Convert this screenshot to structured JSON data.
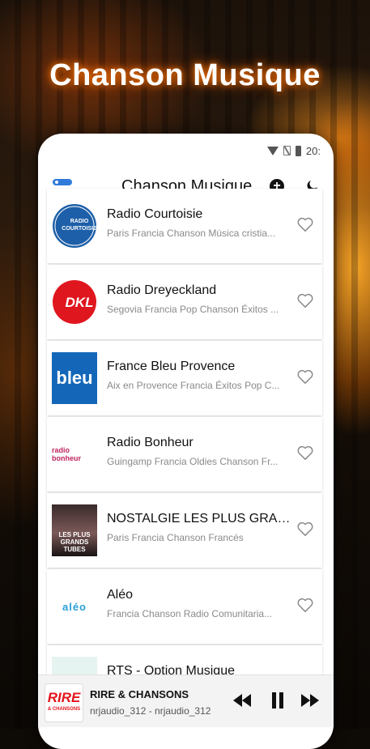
{
  "promo": {
    "title": "Chanson Musique"
  },
  "status_bar": {
    "time": "20:"
  },
  "app_bar": {
    "title": "Chanson Musique"
  },
  "stations": [
    {
      "name": "Radio Courtoisie",
      "description": "Paris Francia Chanson Música cristia...",
      "logo_text": "RADIO COURTOISIE"
    },
    {
      "name": "Radio Dreyeckland",
      "description": "Segovia Francia Pop Chanson Éxitos ...",
      "logo_text": "DKL"
    },
    {
      "name": "France Bleu Provence",
      "description": "Aix en Provence Francia Éxitos Pop C...",
      "logo_text": "bleu"
    },
    {
      "name": "Radio Bonheur",
      "description": "Guingamp Francia Oldies Chanson Fr...",
      "logo_text": "radio bonheur"
    },
    {
      "name": "NOSTALGIE LES PLUS GRAN...",
      "description": "Paris Francia Chanson Francés",
      "logo_text": "LES PLUS GRANDS TUBES"
    },
    {
      "name": "Aléo",
      "description": "Francia Chanson Radio Comunitaria...",
      "logo_text": "aléo"
    },
    {
      "name": "RTS - Option Musique",
      "description": "",
      "logo_text": ""
    }
  ],
  "player": {
    "title": "RIRE & CHANSONS",
    "subtitle": "nrjaudio_312 - nrjaudio_312",
    "logo_text": "RIRE",
    "logo_sub": "& CHANSONS"
  },
  "colors": {
    "accent_blue": "#2f7bd9",
    "heart": "#888888"
  }
}
